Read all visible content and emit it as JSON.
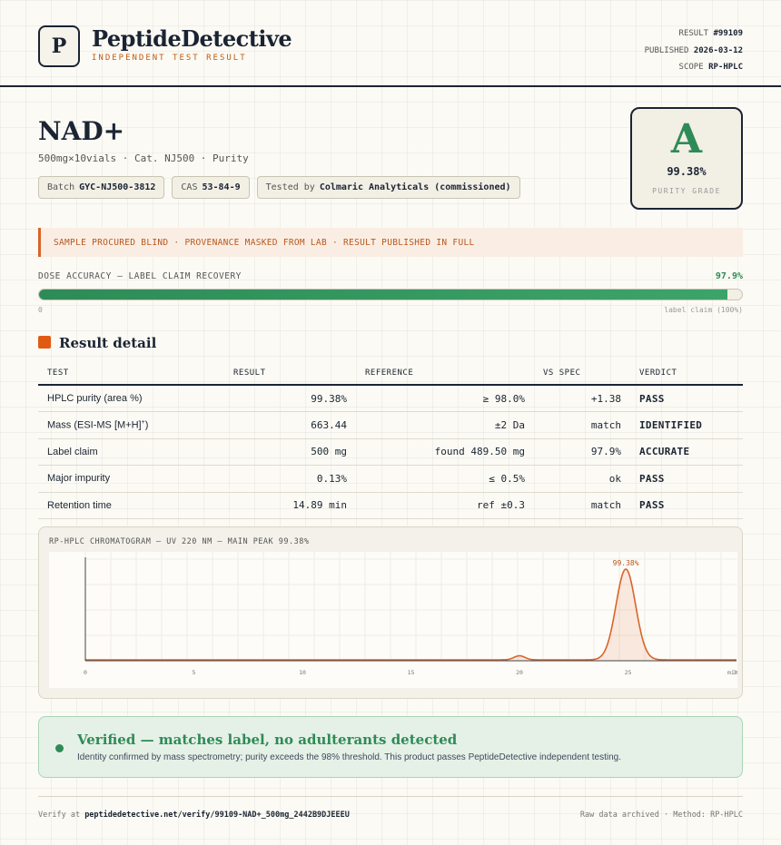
{
  "header": {
    "logo_letter": "P",
    "brand": "PeptideDetective",
    "tagline": "INDEPENDENT TEST RESULT",
    "result_label": "RESULT",
    "result_value": "#99109",
    "published_label": "PUBLISHED",
    "published_value": "2026-03-12",
    "scope_label": "SCOPE",
    "scope_value": "RP-HPLC"
  },
  "product": {
    "name": "NAD+",
    "subtitle": "500mg×10vials · Cat. NJ500 · Purity",
    "batch_label": "Batch",
    "batch_value": "GYC-NJ500-3812",
    "cas_label": "CAS",
    "cas_value": "53-84-9",
    "tested_label": "Tested by",
    "tested_value": "Colmaric Analyticals (commissioned)"
  },
  "grade": {
    "letter": "A",
    "value": "99.38%",
    "label": "PURITY GRADE"
  },
  "banner": "SAMPLE PROCURED BLIND · PROVENANCE MASKED FROM LAB · RESULT PUBLISHED IN FULL",
  "dose": {
    "label": "DOSE ACCURACY — LABEL CLAIM RECOVERY",
    "percent_text": "97.9%",
    "percent": 97.9,
    "min_label": "0",
    "max_label": "label claim (100%)"
  },
  "result_detail": {
    "title": "Result detail",
    "headers": [
      "TEST",
      "RESULT",
      "REFERENCE",
      "VS SPEC",
      "VERDICT"
    ],
    "rows": [
      {
        "test": "HPLC purity (area %)",
        "result": "99.38%",
        "reference": "≥ 98.0%",
        "vs_spec": "+1.38",
        "verdict": "PASS"
      },
      {
        "test": "Mass (ESI-MS [M+H]",
        "test_sup": "+",
        "test_tail": ")",
        "result": "663.44",
        "reference": "±2 Da",
        "vs_spec": "match",
        "verdict": "IDENTIFIED"
      },
      {
        "test": "Label claim",
        "result": "500 mg",
        "reference": "found 489.50 mg",
        "vs_spec": "97.9%",
        "verdict": "ACCURATE"
      },
      {
        "test": "Major impurity",
        "result": "0.13%",
        "reference": "≤ 0.5%",
        "vs_spec": "ok",
        "verdict": "PASS"
      },
      {
        "test": "Retention time",
        "result": "14.89 min",
        "reference": "ref ±0.3",
        "vs_spec": "match",
        "verdict": "PASS"
      }
    ]
  },
  "chart_data": {
    "type": "area",
    "title": "RP-HPLC CHROMATOGRAM — UV 220 NM — MAIN PEAK 99.38%",
    "xlabel": "",
    "ylabel": "",
    "xlim": [
      0,
      30
    ],
    "x_ticks": [
      "0",
      "5",
      "10",
      "15",
      "20",
      "25",
      "30"
    ],
    "x_unit": "min",
    "grid": true,
    "peaks": [
      {
        "x": 20.0,
        "height": 0.045,
        "width": 0.25
      },
      {
        "x": 24.9,
        "height": 1.0,
        "width": 0.45,
        "label": "99.38%"
      }
    ],
    "baseline": 0.01,
    "color": "#d9642a"
  },
  "verified": {
    "title": "Verified — matches label, no adulterants detected",
    "description": "Identity confirmed by mass spectrometry; purity exceeds the 98% threshold. This product passes PeptideDetective independent testing."
  },
  "footer": {
    "verify_label": "Verify at",
    "verify_url": "peptidedetective.net/verify/99109-NAD+_500mg_2442B9DJEEEU",
    "right_text": "Raw data archived · Method: RP-HPLC"
  },
  "colors": {
    "accent_green": "#2e8b57",
    "accent_orange": "#d9642a",
    "ink": "#1b2433"
  }
}
